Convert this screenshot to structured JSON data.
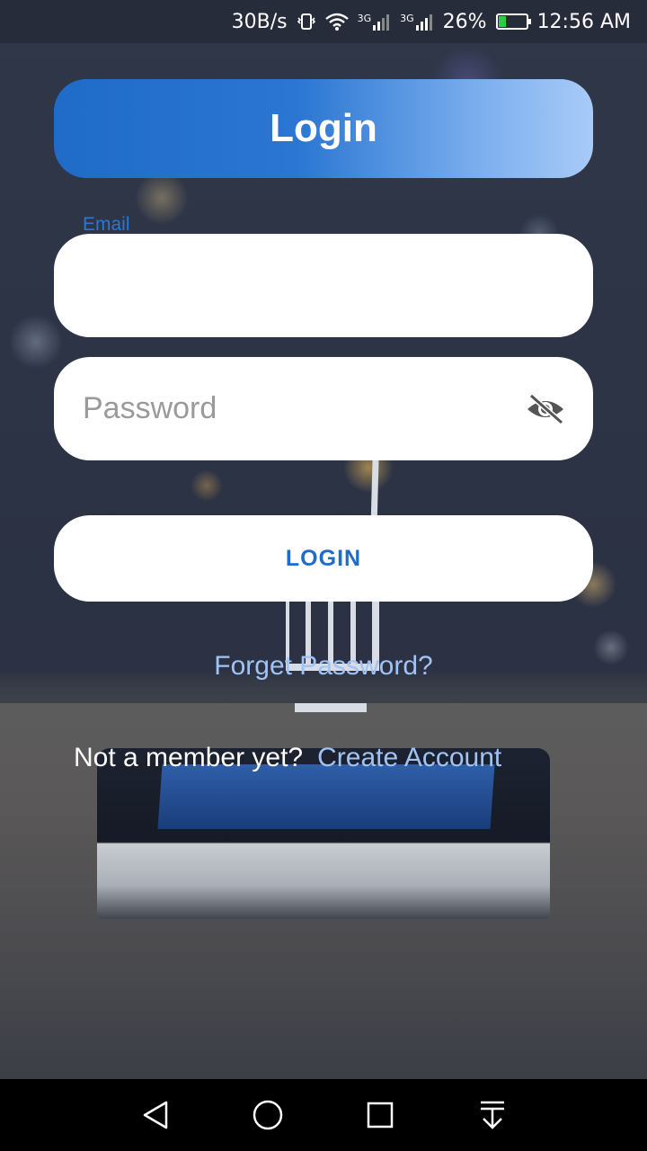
{
  "status_bar": {
    "net_speed": "30B/s",
    "signal1_label": "3G",
    "signal2_label": "3G",
    "battery_percent": "26%",
    "time": "12:56 AM",
    "battery_level": 0.26
  },
  "header": {
    "title": "Login"
  },
  "form": {
    "email_label": "Email",
    "email_value": "",
    "password_placeholder": "Password",
    "password_value": "",
    "login_button": "LOGIN"
  },
  "links": {
    "forget_password": "Forget Password?",
    "not_member": "Not a member yet?",
    "create_account": "Create Account"
  },
  "icons": {
    "password_toggle": "eye-off-icon",
    "nav_back": "back-triangle-icon",
    "nav_home": "home-circle-icon",
    "nav_recents": "recents-square-icon",
    "nav_notifications": "pull-down-icon"
  },
  "colors": {
    "accent": "#1f6cc8",
    "link": "#9fc3f5",
    "header_gradient_end": "#a8cbf7"
  }
}
